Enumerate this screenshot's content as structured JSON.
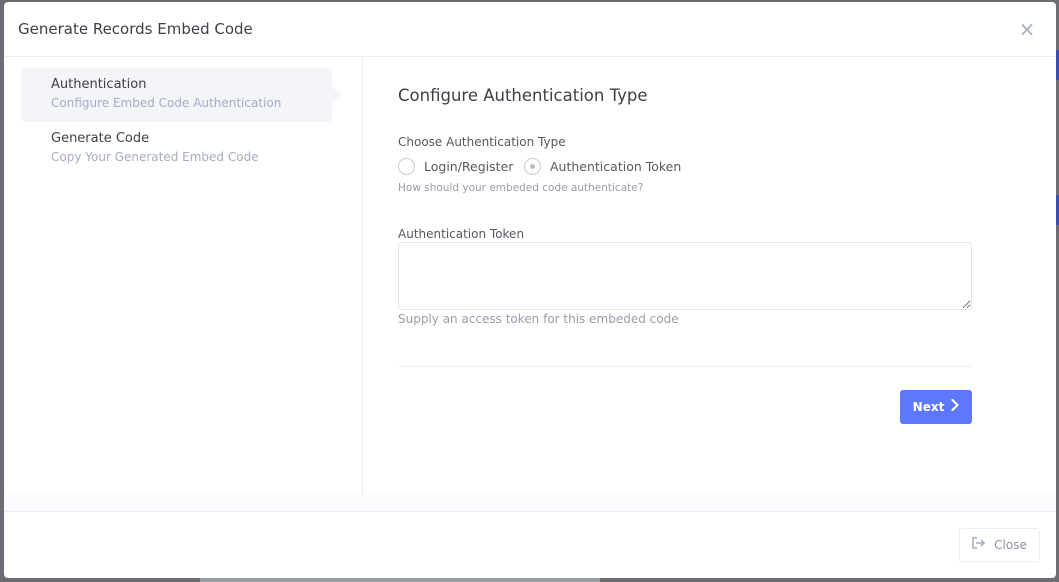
{
  "modal": {
    "title": "Generate Records Embed Code",
    "close_symbol": "×"
  },
  "wizard": {
    "steps": [
      {
        "title": "Authentication",
        "subtitle": "Configure Embed Code Authentication",
        "active": true
      },
      {
        "title": "Generate Code",
        "subtitle": "Copy Your Generated Embed Code",
        "active": false
      }
    ]
  },
  "form": {
    "heading": "Configure Authentication Type",
    "auth_type_label": "Choose Authentication Type",
    "options": [
      {
        "label": "Login/Register",
        "checked": false
      },
      {
        "label": "Authentication Token",
        "checked": true
      }
    ],
    "auth_type_help": "How should your embeded code authenticate?",
    "token_label": "Authentication Token",
    "token_value": "",
    "token_help": "Supply an access token for this embeded code",
    "next_label": "Next",
    "next_icon": "chevron-right-icon"
  },
  "footer": {
    "close_label": "Close",
    "close_icon": "sign-out-icon"
  },
  "colors": {
    "primary": "#5d78ff",
    "text": "#3f4047",
    "muted": "#a7abc3"
  }
}
